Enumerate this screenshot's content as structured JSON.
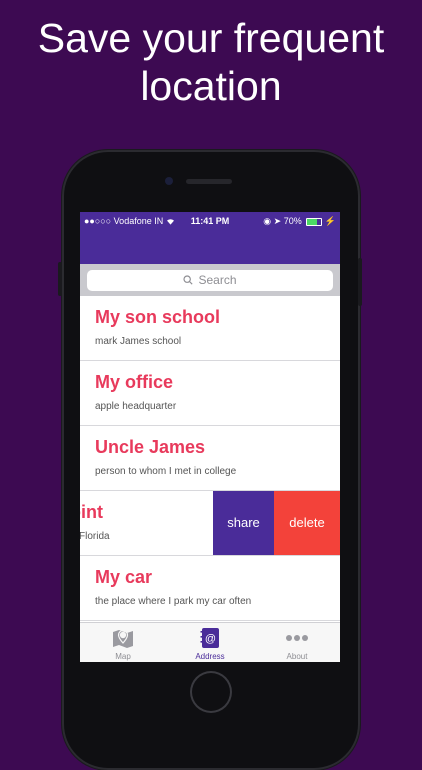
{
  "headline": {
    "line1": "Save your frequent",
    "line2": "location"
  },
  "status_bar": {
    "carrier": "●●○○○ Vodafone IN",
    "time": "11:41 PM",
    "battery": "70%",
    "battery_level": 0.7
  },
  "search": {
    "placeholder": "Search"
  },
  "addresses": [
    {
      "name": "My son school",
      "description": "mark James school"
    },
    {
      "name": "My office",
      "description": "apple headquarter"
    },
    {
      "name": "Uncle James",
      "description": "person to whom I met in college"
    },
    {
      "name": "point",
      "description": "Florida"
    },
    {
      "name": "My car",
      "description": "the place where I park my car often"
    }
  ],
  "swipe_actions": {
    "share": "share",
    "delete": "delete"
  },
  "tabs": [
    {
      "label": "Map",
      "icon": "map-icon"
    },
    {
      "label": "Address",
      "icon": "address-book-icon"
    },
    {
      "label": "About",
      "icon": "more-dots-icon"
    }
  ],
  "colors": {
    "background": "#3d0a52",
    "nav_bar": "#4a2c99",
    "title_text": "#e83a5c",
    "share": "#4a2c99",
    "delete": "#f3423a",
    "tab_active": "#4a2c99",
    "tab_inactive": "#8e8e93"
  }
}
